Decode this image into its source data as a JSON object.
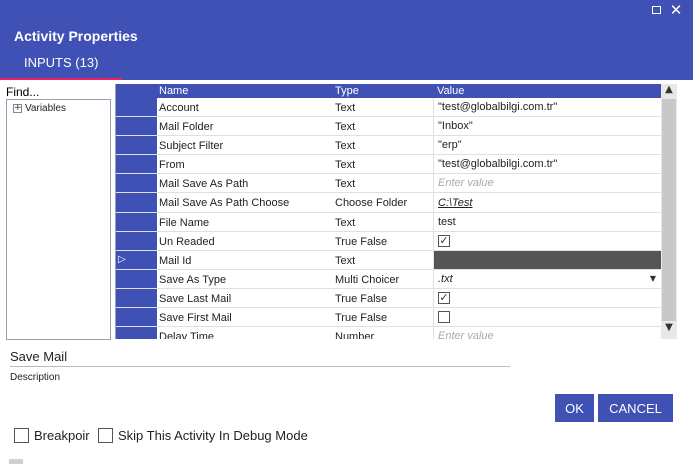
{
  "window": {
    "maximize_icon": "maximize-icon",
    "close_icon": "close-icon",
    "close_glyph": "✕"
  },
  "header": {
    "title": "Activity Properties",
    "tab_label": "INPUTS (13)",
    "accent_color": "#3f51b5",
    "tab_indicator_color": "#e91e63"
  },
  "left_panel": {
    "find_label": "Find...",
    "tree_items": [
      {
        "expander": "+",
        "label": "Variables"
      }
    ]
  },
  "grid": {
    "columns": {
      "name": "Name",
      "type": "Type",
      "value": "Value"
    },
    "rows": [
      {
        "name": "Account",
        "type": "Text",
        "value": "\"test@globalbilgi.com.tr\"",
        "kind": "text"
      },
      {
        "name": "Mail Folder",
        "type": "Text",
        "value": "\"Inbox\"",
        "kind": "text"
      },
      {
        "name": "Subject Filter",
        "type": "Text",
        "value": "\"erp\"",
        "kind": "text"
      },
      {
        "name": "From",
        "type": "Text",
        "value": "\"test@globalbilgi.com.tr\"",
        "kind": "text"
      },
      {
        "name": "Mail Save As Path",
        "type": "Text",
        "value": "Enter value",
        "kind": "placeholder"
      },
      {
        "name": "Mail Save As Path Choose",
        "type": "Choose Folder",
        "value": "C:\\Test",
        "kind": "link"
      },
      {
        "name": "File Name",
        "type": "Text",
        "value": "test",
        "kind": "text"
      },
      {
        "name": "Un Readed",
        "type": "True False",
        "value": "✓",
        "kind": "checkbox"
      },
      {
        "name": "Mail Id",
        "type": "Text",
        "value": "",
        "kind": "dark",
        "selected_glyph": "▷"
      },
      {
        "name": "Save As Type",
        "type": "Multi Choicer",
        "value": ".txt",
        "kind": "dropdown",
        "arrow": "▼"
      },
      {
        "name": "Save Last Mail",
        "type": "True False",
        "value": "✓",
        "kind": "checkbox"
      },
      {
        "name": "Save First Mail",
        "type": "True False",
        "value": "",
        "kind": "checkbox"
      },
      {
        "name": "Delay Time",
        "type": "Number",
        "value": "Enter value",
        "kind": "placeholder"
      }
    ]
  },
  "scrollbar": {
    "up_glyph": "▲",
    "down_glyph": "▼"
  },
  "footer": {
    "activity_name": "Save Mail",
    "description_label": "Description",
    "ok_label": "OK",
    "cancel_label": "CANCEL",
    "breakpoint_label": "Breakpoir",
    "skip_label": "Skip This Activity In Debug Mode"
  }
}
